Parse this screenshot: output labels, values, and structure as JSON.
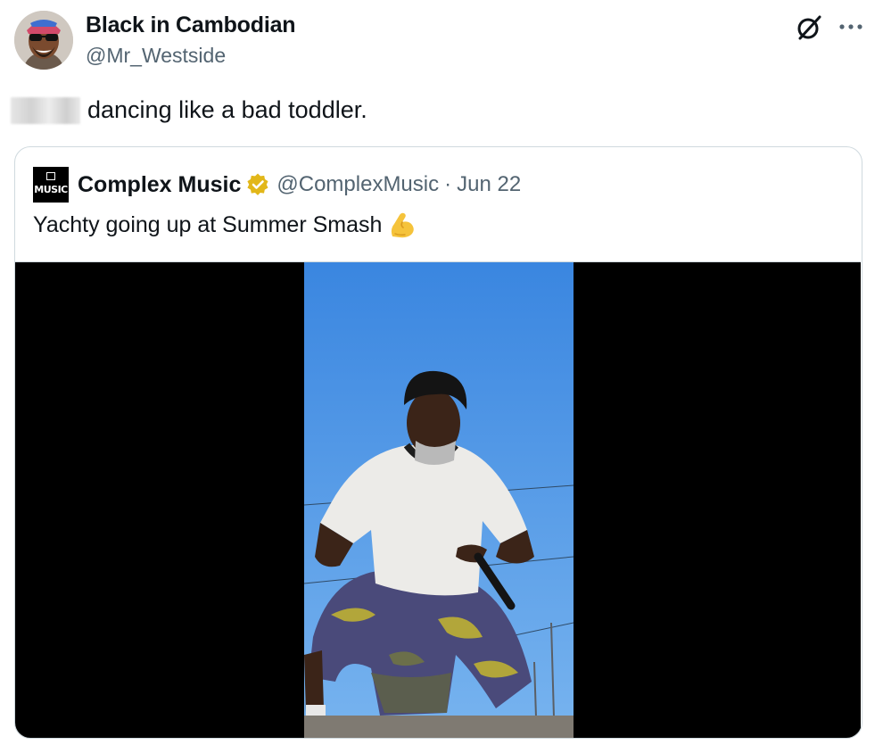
{
  "author": {
    "name": "Black in Cambodian",
    "handle": "@Mr_Westside",
    "avatar_icon": "profile-photo"
  },
  "tweet": {
    "text": "dancing like a bad toddler."
  },
  "icons": {
    "grok": "grok-slash-circle-icon",
    "more": "more-dots-icon"
  },
  "quoted": {
    "name": "Complex Music",
    "logo_text": "MUSIC",
    "handle": "@ComplexMusic",
    "separator": "·",
    "date": "Jun 22",
    "text": "Yachty going up at Summer Smash",
    "emoji": "flexed-biceps-icon",
    "verified_color": "#e2b719"
  },
  "media": {
    "type": "video",
    "sky_color": "#4a95e6",
    "letterbox_color": "#000000"
  }
}
